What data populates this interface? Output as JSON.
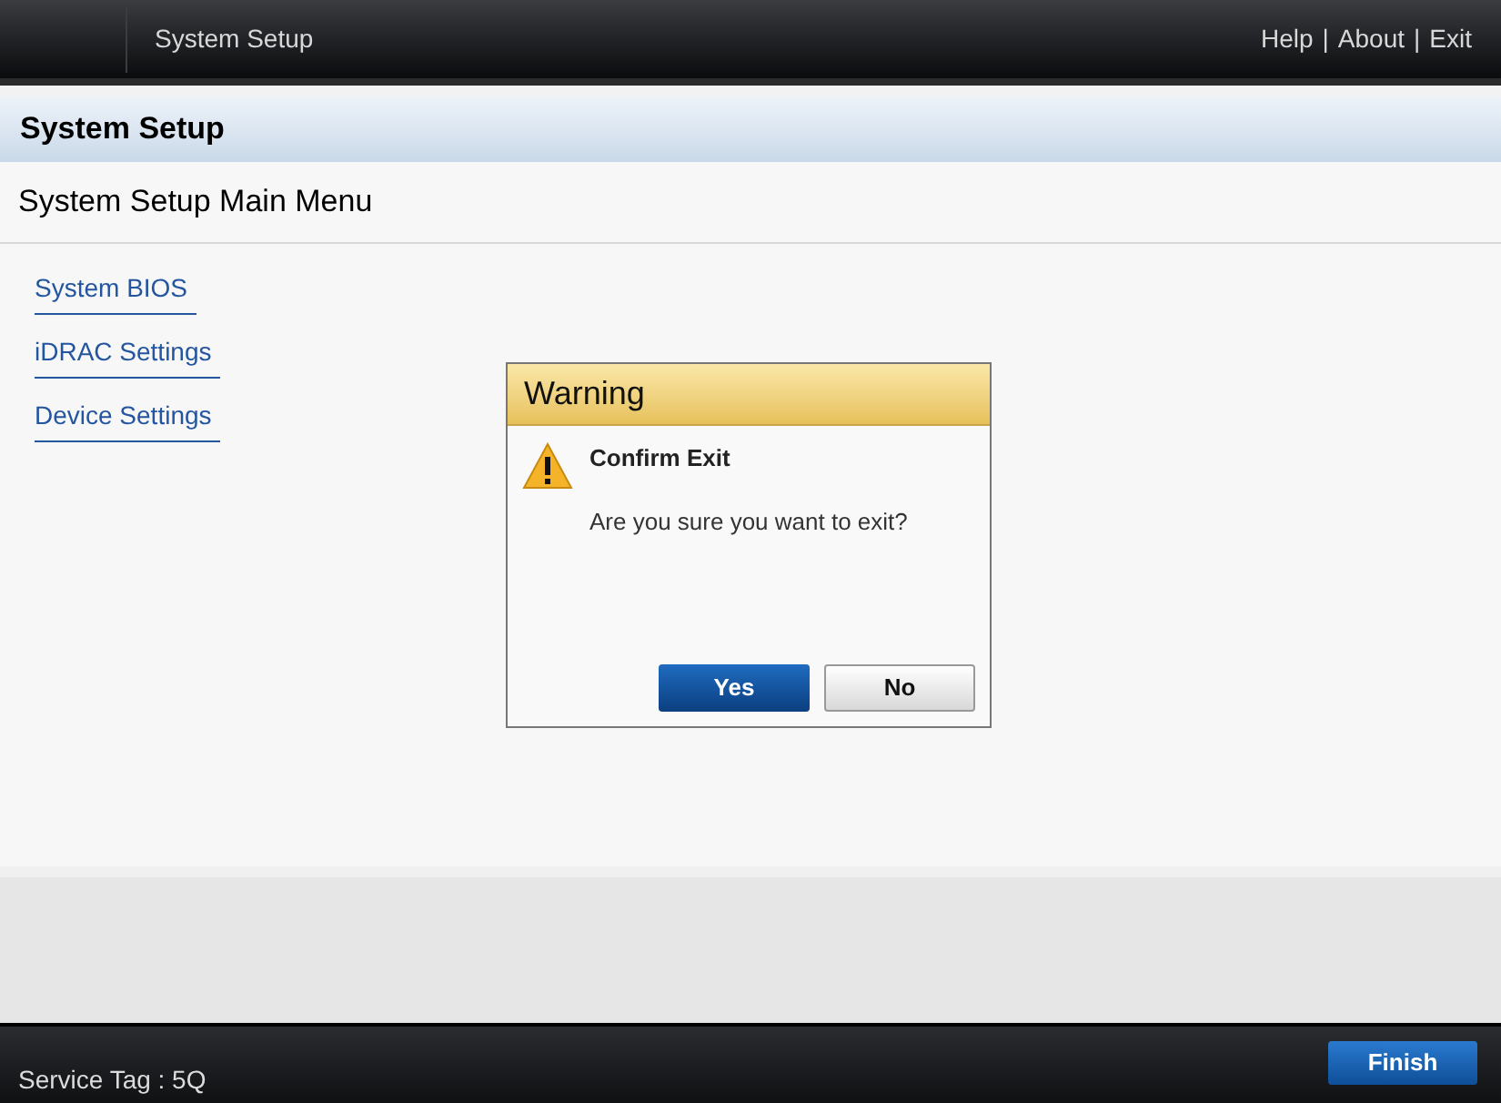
{
  "header": {
    "title": "System Setup",
    "links": [
      "Help",
      "About",
      "Exit"
    ],
    "separator": "|"
  },
  "page_title": "System Setup",
  "menu": {
    "heading": "System Setup Main Menu",
    "items": [
      "System BIOS",
      "iDRAC Settings",
      "Device Settings"
    ]
  },
  "dialog": {
    "title": "Warning",
    "heading": "Confirm Exit",
    "message": "Are you sure you want to exit?",
    "buttons": [
      {
        "label": "Yes",
        "kind": "primary"
      },
      {
        "label": "No",
        "kind": "secondary"
      }
    ]
  },
  "footer": {
    "service_tag": "Service Tag : 5Q",
    "button": "Finish"
  }
}
